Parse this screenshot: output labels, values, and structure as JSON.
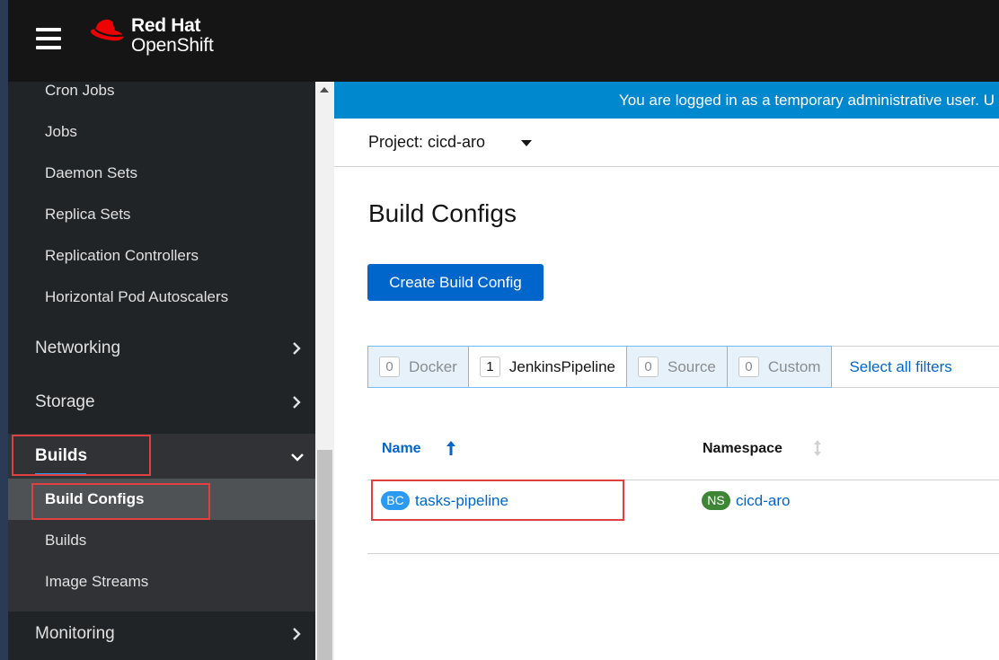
{
  "masthead": {
    "brand": "Red Hat",
    "product": "OpenShift"
  },
  "sidebar": {
    "workload_items": [
      "Cron Jobs",
      "Jobs",
      "Daemon Sets",
      "Replica Sets",
      "Replication Controllers",
      "Horizontal Pod Autoscalers"
    ],
    "networking": "Networking",
    "storage": "Storage",
    "builds": {
      "label": "Builds",
      "items": [
        "Build Configs",
        "Builds",
        "Image Streams"
      ]
    },
    "monitoring": "Monitoring"
  },
  "banner": {
    "text": "You are logged in as a temporary administrative user. U"
  },
  "project": {
    "label": "Project: cicd-aro"
  },
  "page": {
    "title": "Build Configs",
    "create_button": "Create Build Config"
  },
  "filters": [
    {
      "count": "0",
      "label": "Docker",
      "active": false
    },
    {
      "count": "1",
      "label": "JenkinsPipeline",
      "active": true
    },
    {
      "count": "0",
      "label": "Source",
      "active": false
    },
    {
      "count": "0",
      "label": "Custom",
      "active": false
    }
  ],
  "select_all": "Select all filters",
  "table": {
    "columns": [
      "Name",
      "Namespace"
    ],
    "rows": [
      {
        "name_badge": "BC",
        "name": "tasks-pipeline",
        "ns_badge": "NS",
        "namespace": "cicd-aro"
      }
    ]
  },
  "colors": {
    "accent": "#0066cc",
    "banner": "#0088ce",
    "highlight": "#e04040",
    "masthead": "#151515",
    "sidebar": "#212427"
  }
}
